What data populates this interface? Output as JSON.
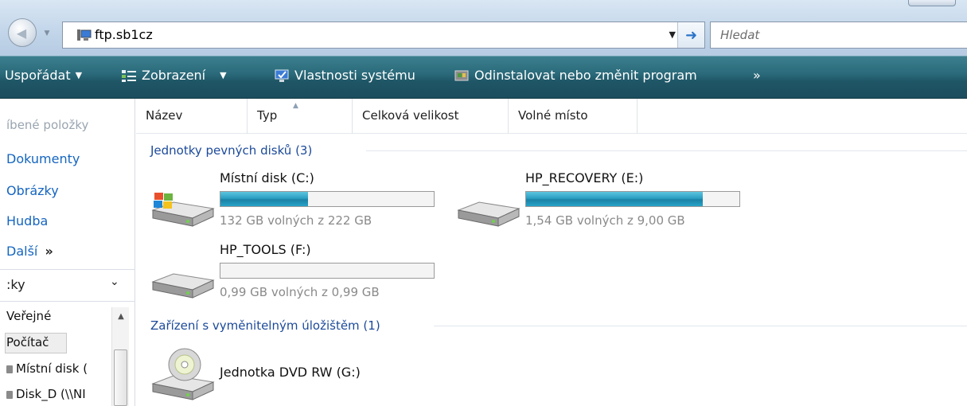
{
  "address_bar": {
    "path": "ftp.sb1cz",
    "search_placeholder": "Hledat"
  },
  "command_bar": {
    "organize": "Uspořádat",
    "views": "Zobrazení",
    "system_properties": "Vlastnosti systému",
    "uninstall": "Odinstalovat nebo změnit program",
    "more": "»"
  },
  "nav_pane": {
    "favorites_header": "íbené položky",
    "links": [
      "Dokumenty",
      "Obrázky",
      "Hudba",
      "Další"
    ],
    "more_glyph": "»",
    "folders_header": ":ky",
    "tree": [
      "Veřejné",
      "Počítač",
      "Místní disk (",
      "Disk_D (\\\\NI"
    ]
  },
  "columns": [
    "Název",
    "Typ",
    "Celková velikost",
    "Volné místo"
  ],
  "groups": {
    "hard_disks": "Jednotky pevných disků (3)",
    "removable": "Zařízení s vyměnitelným úložištěm (1)"
  },
  "drives": [
    {
      "name": "Místní disk (C:)",
      "space": "132 GB volných z 222 GB",
      "used_fraction": 0.41
    },
    {
      "name": "HP_RECOVERY (E:)",
      "space": "1,54 GB volných z 9,00 GB",
      "used_fraction": 0.83
    },
    {
      "name": "HP_TOOLS (F:)",
      "space": "0,99 GB volných z 0,99 GB",
      "used_fraction": 0.0
    }
  ],
  "removable_drives": [
    {
      "name": "Jednotka DVD RW (G:)"
    }
  ],
  "colors": {
    "command_bar": "#2b6b7b",
    "link_blue": "#1565c0",
    "group_header": "#1c4a9a",
    "drive_fill": "#2a9fc2"
  }
}
